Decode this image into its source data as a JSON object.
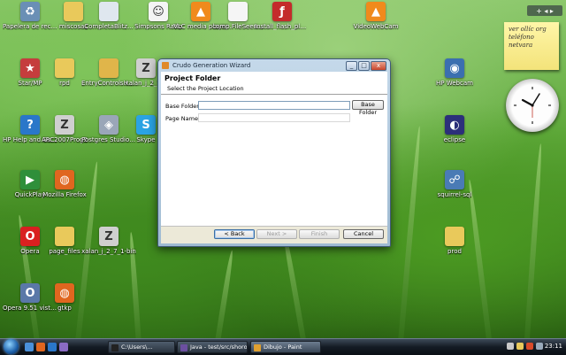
{
  "desktop": {
    "icons": [
      {
        "label": "Papelera de reciclaje",
        "icon": "recycle-bin-icon",
        "color": "#6a8fb5",
        "glyph": "♻"
      },
      {
        "label": "miscosas",
        "icon": "folder-icon",
        "color": "#e9c95b",
        "glyph": ""
      },
      {
        "label": "CompletaBlitz...",
        "icon": "document-icon",
        "color": "#dfe7ef",
        "glyph": ""
      },
      {
        "label": "Simpsons Ratio",
        "icon": "cartoon-icon",
        "color": "#f4f4f4",
        "glyph": "☺"
      },
      {
        "label": "VLC media player",
        "icon": "vlc-cone-icon",
        "color": "#f08a1c",
        "glyph": "▲"
      },
      {
        "label": "comp.FileSeen...",
        "icon": "document-icon",
        "color": "#f5f5f5",
        "glyph": ""
      },
      {
        "label": "Install_flash_pla...",
        "icon": "flash-installer-icon",
        "color": "#c42b2b",
        "glyph": "ƒ"
      },
      {
        "label": "VideoWebCam",
        "icon": "vlc-cone-icon",
        "color": "#f08a1c",
        "glyph": "▲"
      },
      {
        "label": "Star/MP",
        "icon": "star-icon",
        "color": "#c53d3d",
        "glyph": "★"
      },
      {
        "label": "rpd",
        "icon": "folder-icon",
        "color": "#e9c95b",
        "glyph": ""
      },
      {
        "label": "EntryControlsHa...",
        "icon": "archive-icon",
        "color": "#e0b54a",
        "glyph": ""
      },
      {
        "label": "xalan_j_2_7...",
        "icon": "zip-icon",
        "color": "#cfcfcf",
        "glyph": "Z"
      },
      {
        "label": "HP Webcam",
        "icon": "webcam-icon",
        "color": "#3b6fb0",
        "glyph": "◉"
      },
      {
        "label": "HP Help and Support",
        "icon": "help-icon",
        "color": "#2a77c9",
        "glyph": "?"
      },
      {
        "label": "ARC2007Prog2",
        "icon": "zip-icon",
        "color": "#cfcfcf",
        "glyph": "Z"
      },
      {
        "label": "Postgres Studio 8.2",
        "icon": "elephant-icon",
        "color": "#9aa6b8",
        "glyph": "◈"
      },
      {
        "label": "Skype",
        "icon": "skype-icon",
        "color": "#2aa3e3",
        "glyph": "S"
      },
      {
        "label": "eclipse",
        "icon": "eclipse-icon",
        "color": "#2c2f7a",
        "glyph": "◐"
      },
      {
        "label": "QuickPlay",
        "icon": "quickplay-icon",
        "color": "#2f8f3a",
        "glyph": "▶"
      },
      {
        "label": "Mozilla Firefox",
        "icon": "firefox-icon",
        "color": "#e0661f",
        "glyph": "◍"
      },
      {
        "label": "squirrel-sql",
        "icon": "squirrel-icon",
        "color": "#4a7bb5",
        "glyph": "☍"
      },
      {
        "label": "Opera",
        "icon": "opera-icon",
        "color": "#d92020",
        "glyph": "O"
      },
      {
        "label": "page_files",
        "icon": "folder-icon",
        "color": "#e9c95b",
        "glyph": ""
      },
      {
        "label": "xalan_j_2_7_1-bin",
        "icon": "zip-icon",
        "color": "#cfcfcf",
        "glyph": "Z"
      },
      {
        "label": "prod",
        "icon": "folder-icon",
        "color": "#e9c95b",
        "glyph": ""
      },
      {
        "label": "Opera 9.51 vista-Seg...",
        "icon": "opera-setup-icon",
        "color": "#5a78a8",
        "glyph": "O"
      },
      {
        "label": "gtkp",
        "icon": "firefox-icon",
        "color": "#e0661f",
        "glyph": "◍"
      }
    ]
  },
  "sidebar": {
    "header": "+ ◂ ▸",
    "note_lines": [
      "ver ollíc org",
      "teléfono",
      "netvara"
    ]
  },
  "window": {
    "title": "Crudo Generation Wizard",
    "min": "_",
    "max": "□",
    "close": "x",
    "header_title": "Project Folder",
    "header_desc": "Select the Project Location",
    "base_folder_label": "Base Folder :",
    "base_folder_value": "",
    "browse_label": "Base Folder",
    "page_name_label": "Page Name :",
    "page_name_value": "",
    "back_label": "< Back",
    "next_label": "Next >",
    "finish_label": "Finish",
    "cancel_label": "Cancel"
  },
  "taskbar": {
    "tasks": [
      {
        "label": "C:\\Users\\...",
        "color": "#222222"
      },
      {
        "label": "Java - test/src/shorooq...",
        "color": "#6b4fa0"
      },
      {
        "label": "Dibujo - Paint",
        "color": "#e0a030"
      }
    ],
    "clock": "23:11"
  },
  "colors": {
    "accent": "#3a6ea5",
    "window_frame": "#9fbbd2"
  }
}
